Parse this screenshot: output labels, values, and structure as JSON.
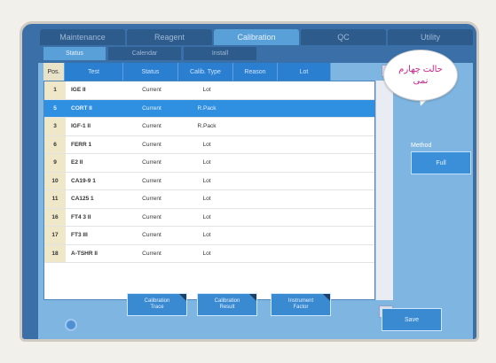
{
  "main_tabs": [
    "Maintenance",
    "Reagent",
    "Calibration",
    "QC",
    "Utility"
  ],
  "active_main_tab_index": 2,
  "sub_tabs": [
    "Status",
    "Calendar",
    "Install"
  ],
  "active_sub_tab_index": 0,
  "table": {
    "columns": [
      "Pos.",
      "Test",
      "Status",
      "Calib. Type",
      "Reason",
      "Lot"
    ],
    "rows": [
      {
        "pos": "1",
        "test": "IGE II",
        "status": "Current",
        "type": "Lot"
      },
      {
        "pos": "5",
        "test": "CORT II",
        "status": "Current",
        "type": "R.Pack"
      },
      {
        "pos": "3",
        "test": "IGF-1 II",
        "status": "Current",
        "type": "R.Pack"
      },
      {
        "pos": "6",
        "test": "FERR 1",
        "status": "Current",
        "type": "Lot"
      },
      {
        "pos": "9",
        "test": "E2 II",
        "status": "Current",
        "type": "Lot"
      },
      {
        "pos": "10",
        "test": "CA19-9 1",
        "status": "Current",
        "type": "Lot"
      },
      {
        "pos": "11",
        "test": "CA125 1",
        "status": "Current",
        "type": "Lot"
      },
      {
        "pos": "16",
        "test": "FT4 3 II",
        "status": "Current",
        "type": "Lot"
      },
      {
        "pos": "17",
        "test": "FT3 III",
        "status": "Current",
        "type": "Lot"
      },
      {
        "pos": "18",
        "test": "A-TSHR II",
        "status": "Current",
        "type": "Lot"
      }
    ],
    "selected_row_index": 1
  },
  "method": {
    "label": "Method",
    "value": "Full"
  },
  "buttons": {
    "calibration_trace": "Calibration\nTrace",
    "calibration_result": "Calibration\nResult",
    "instrument_factor": "Instrument\nFactor",
    "save": "Save"
  },
  "annotation": {
    "line1": "حالت چهارم",
    "line2": "نمی"
  },
  "icons": {
    "sort": "sort-up-icon",
    "scroll": "scroll-down-icon",
    "home": "home-icon"
  }
}
